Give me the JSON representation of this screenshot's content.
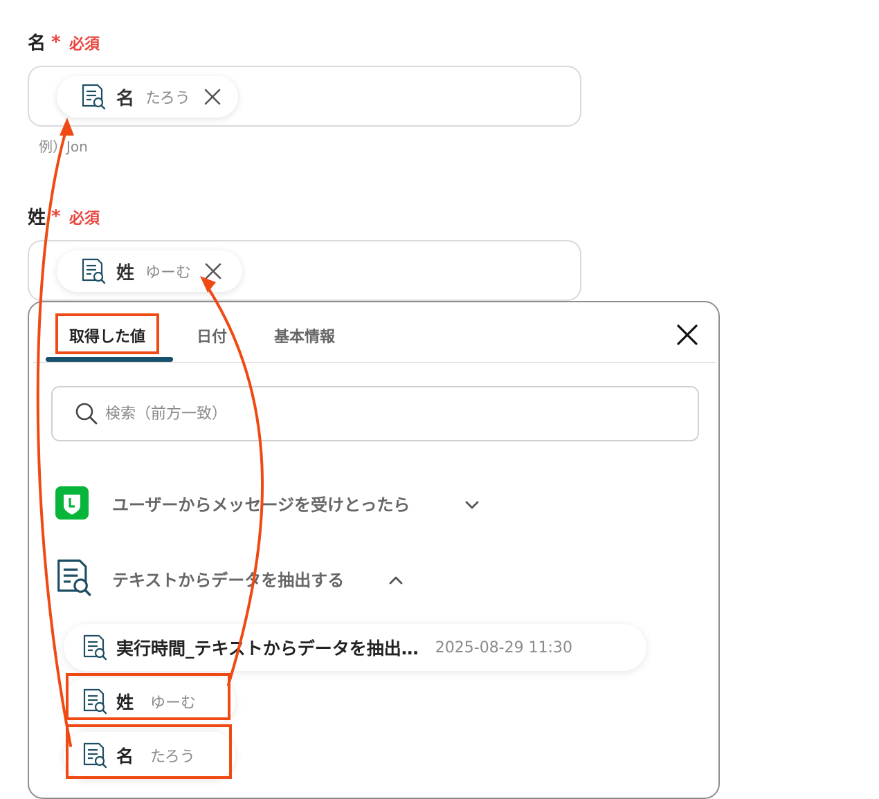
{
  "first_name_field": {
    "label": "名",
    "required_star": "*",
    "required_text": "必須",
    "chip_name": "名",
    "chip_value": "たろう",
    "hint": "例）Jon"
  },
  "last_name_field": {
    "label": "姓",
    "required_star": "*",
    "required_text": "必須",
    "chip_name": "姓",
    "chip_value": "ゆーむ"
  },
  "picker": {
    "tabs": [
      {
        "label": "取得した値",
        "active": true
      },
      {
        "label": "日付",
        "active": false
      },
      {
        "label": "基本情報",
        "active": false
      }
    ],
    "search_placeholder": "検索（前方一致）",
    "groups": [
      {
        "icon": "line-app-icon",
        "label": "ユーザーからメッセージを受けとったら",
        "expanded": false
      },
      {
        "icon": "document-search-icon",
        "label": "テキストからデータを抽出する",
        "expanded": true
      }
    ],
    "items": [
      {
        "name": "実行時間_テキストからデータを抽出…",
        "value": "2025-08-29 11:30"
      },
      {
        "name": "姓",
        "value": "ゆーむ"
      },
      {
        "name": "名",
        "value": "たろう"
      }
    ]
  },
  "colors": {
    "required": "#e8453c",
    "highlight": "#f04a14",
    "tab_underline": "#17506b",
    "line_green": "#07b53b"
  }
}
